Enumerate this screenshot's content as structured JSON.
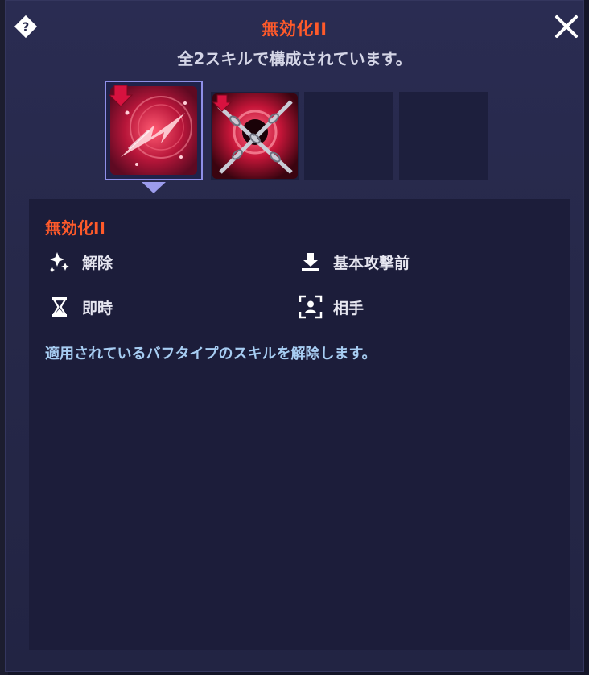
{
  "header": {
    "title": "無効化II",
    "subtitle": "全2スキルで構成されています。"
  },
  "icons": {
    "help": "question-diamond-icon",
    "close": "close-icon"
  },
  "skills": [
    {
      "slot": 1,
      "icon": "red-slash-skill-icon",
      "selected": true
    },
    {
      "slot": 2,
      "icon": "red-chain-skill-icon",
      "selected": false
    },
    {
      "slot": 3,
      "icon": "empty",
      "selected": false
    },
    {
      "slot": 4,
      "icon": "empty",
      "selected": false
    }
  ],
  "detail": {
    "name": "無効化II",
    "attributes": {
      "effect": "解除",
      "timing": "基本攻撃前",
      "duration": "即時",
      "target": "相手"
    },
    "description": "適用されているバフタイプのスキルを解除します。"
  },
  "colors": {
    "accent": "#ff5a2a",
    "description": "#a7cdf2",
    "selection": "#8f8fe8"
  }
}
